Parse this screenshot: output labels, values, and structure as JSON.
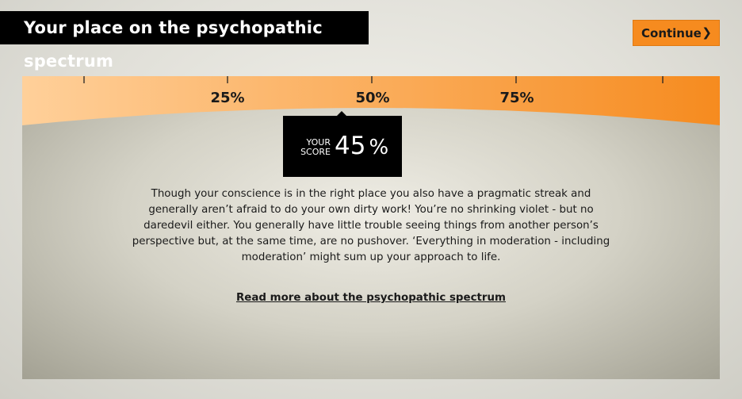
{
  "header": {
    "title": "Your place on the psychopathic spectrum",
    "continue_label": "Continue",
    "continue_icon": "chevron-right-icon"
  },
  "scale": {
    "tick_labels": [
      "25%",
      "50%",
      "75%"
    ],
    "gradient_start": "#ffd09a",
    "gradient_end": "#f68b1f"
  },
  "score": {
    "label_line1": "YOUR",
    "label_line2": "SCORE",
    "value": "45",
    "unit": "%",
    "fraction": 0.45
  },
  "description": "Though your conscience is in the right place you also have a pragmatic streak and generally aren’t afraid to do your own dirty work! You’re no shrinking violet - but no daredevil either. You generally have little trouble seeing things from another person’s perspective but, at the same time, are no pushover. ‘Everything in moderation - including moderation’ might sum up your approach to life.",
  "read_more_label": "Read more about the psychopathic spectrum",
  "colors": {
    "accent": "#f68b1f",
    "title_bg": "#000000"
  }
}
